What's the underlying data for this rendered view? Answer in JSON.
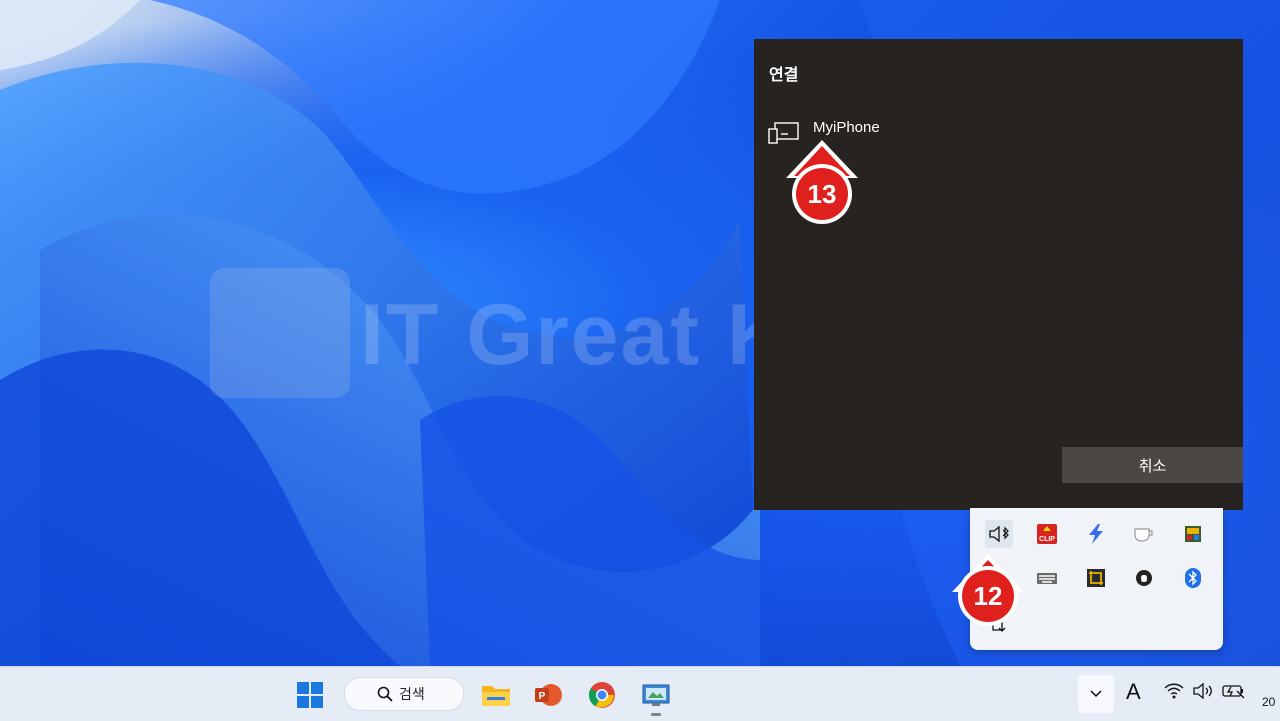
{
  "connect_panel": {
    "title": "연결",
    "devices": [
      {
        "name": "MyiPhone"
      }
    ],
    "cancel_label": "취소"
  },
  "watermark": {
    "text": "IT Great King"
  },
  "markers": {
    "step_12": "12",
    "step_13": "13",
    "color": "#e0201c"
  },
  "tray_overflow": {
    "icons": [
      "bluetooth-audio-icon",
      "clip-icon",
      "lightning-icon",
      "coffee-icon",
      "picture-icon",
      "keyboard-icon",
      "crop-icon",
      "gear-icon",
      "bluetooth-icon",
      "usb-eject-icon"
    ],
    "clip_badge": "CLIP"
  },
  "taskbar": {
    "search_label": "검색",
    "apps": [
      "start-icon",
      "file-explorer-icon",
      "powerpoint-icon",
      "chrome-icon",
      "control-panel-icon"
    ],
    "ime_indicator": "A",
    "clock_fragment": "20"
  },
  "colors": {
    "panel_bg": "#262320",
    "taskbar_bg": "#e6ecf5",
    "accent_blue": "#1a63f0"
  }
}
